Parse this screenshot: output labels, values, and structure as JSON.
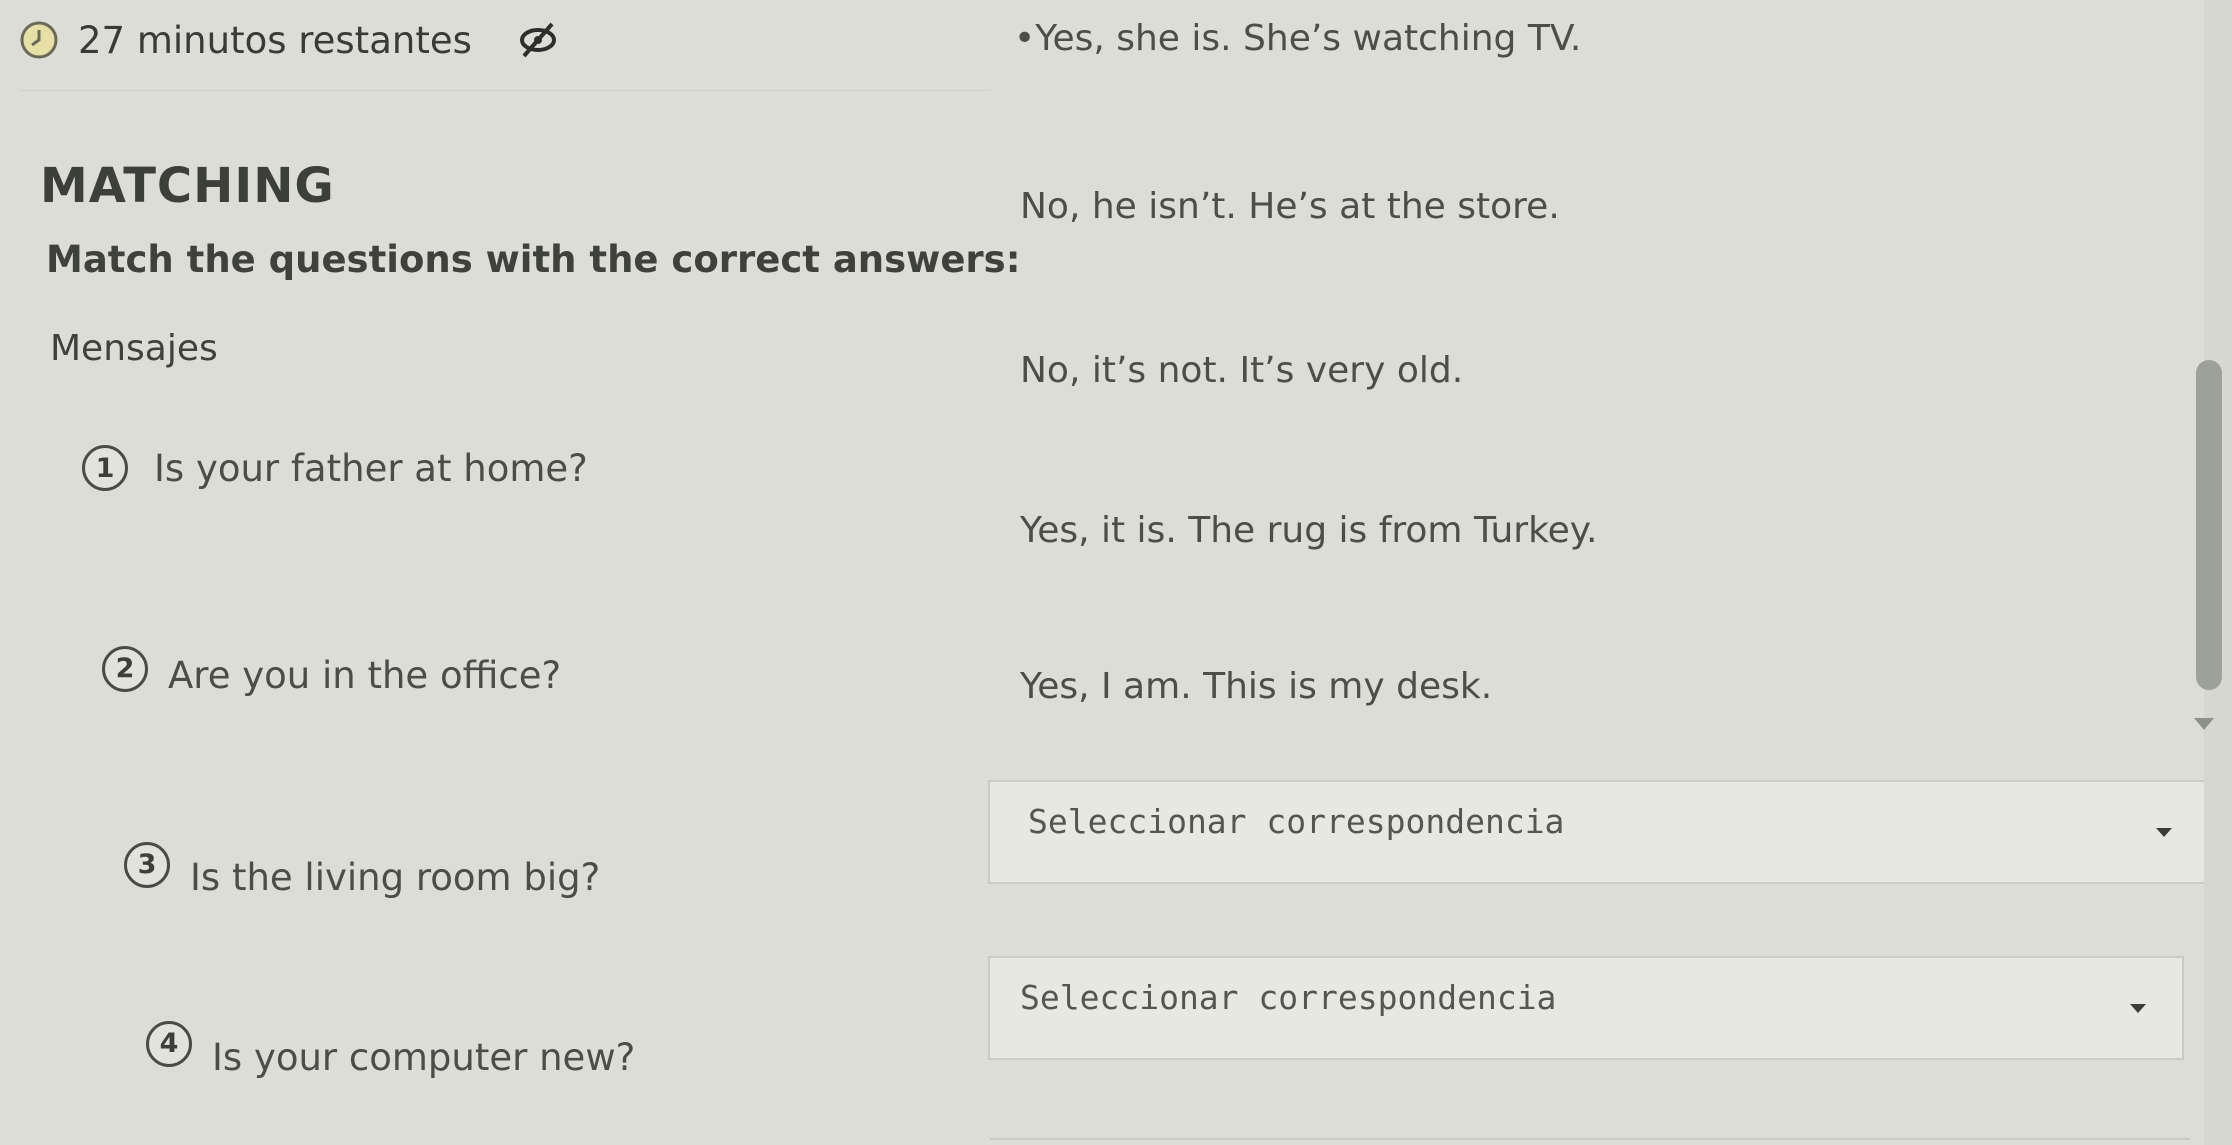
{
  "timer": {
    "text": "27 minutos restantes",
    "icon": "clock-icon",
    "hide_icon": "eye-slash-icon"
  },
  "section": {
    "title": "MATCHING",
    "instructions": "Match the questions with the correct answers:",
    "messages_label": "Mensajes"
  },
  "questions": [
    {
      "number": "1",
      "text": "Is your father at home?"
    },
    {
      "number": "2",
      "text": "Are you in the office?"
    },
    {
      "number": "3",
      "text": "Is the living room big?"
    },
    {
      "number": "4",
      "text": "Is your computer new?"
    }
  ],
  "answers": [
    "•Yes, she is. She’s watching TV.",
    "No, he isn’t. He’s at the store.",
    "No, it’s not. It’s very old.",
    "Yes, it is. The rug is from Turkey.",
    "Yes, I am. This is my desk."
  ],
  "selects": [
    {
      "label": "Seleccionar correspondencia"
    },
    {
      "label": "Seleccionar correspondencia"
    }
  ],
  "colors": {
    "background": "#dcddd7",
    "text": "#3a3b38",
    "select_bg": "#e7e8e2"
  }
}
